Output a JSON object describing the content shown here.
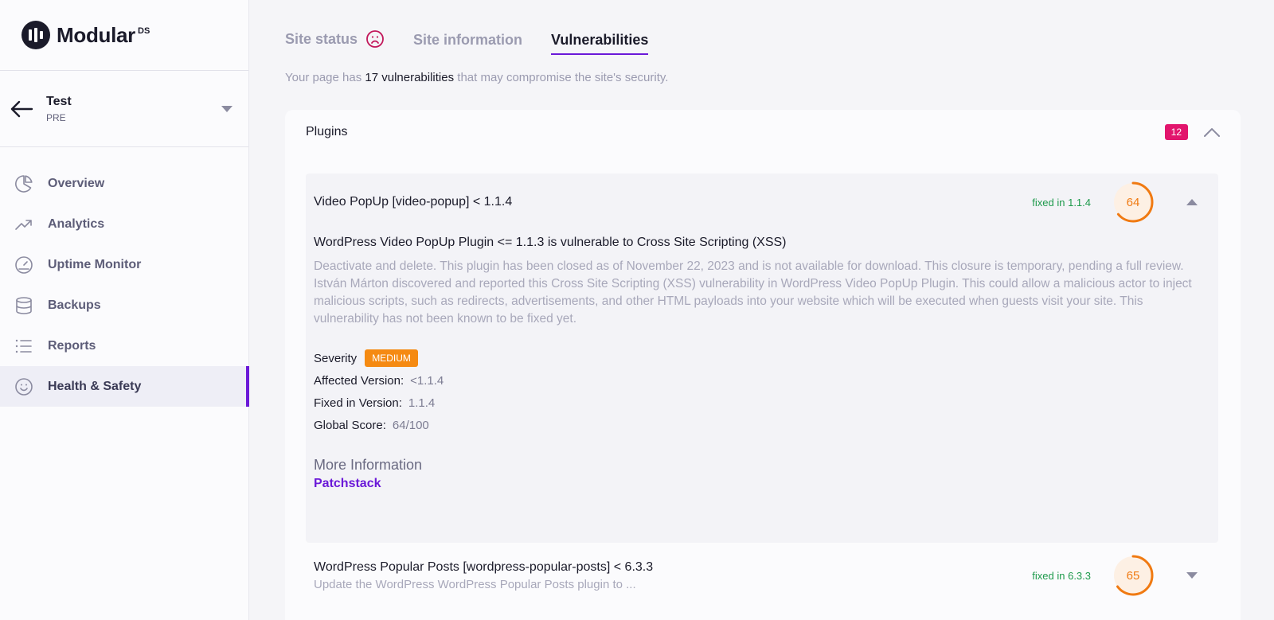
{
  "brand": {
    "name": "Modular",
    "sup": "DS"
  },
  "site": {
    "name": "Test",
    "env": "PRE"
  },
  "nav": [
    {
      "label": "Overview",
      "icon": "pie-chart-icon"
    },
    {
      "label": "Analytics",
      "icon": "trend-up-icon"
    },
    {
      "label": "Uptime Monitor",
      "icon": "gauge-icon"
    },
    {
      "label": "Backups",
      "icon": "database-icon"
    },
    {
      "label": "Reports",
      "icon": "list-icon"
    },
    {
      "label": "Health & Safety",
      "icon": "smile-icon",
      "active": true
    }
  ],
  "tabs": {
    "status": "Site status",
    "info": "Site information",
    "vuln": "Vulnerabilities"
  },
  "intro": {
    "pre": "Your page has ",
    "bold": "17 vulnerabilities",
    "post": " that may compromise the site's security."
  },
  "plugins": {
    "title": "Plugins",
    "count": "12"
  },
  "vuln1": {
    "title": "Video PopUp [video-popup] < 1.1.4",
    "fixed": "fixed in 1.1.4",
    "score": 64,
    "name": "WordPress Video PopUp Plugin <= 1.1.3 is vulnerable to Cross Site Scripting (XSS)",
    "description": "Deactivate and delete. This plugin has been closed as of November 22, 2023 and is not available for download. This closure is temporary, pending a full review. István Márton discovered and reported this Cross Site Scripting (XSS) vulnerability in WordPress Video PopUp Plugin. This could allow a malicious actor to inject malicious scripts, such as redirects, advertisements, and other HTML payloads into your website which will be executed when guests visit your site. This vulnerability has not been known to be fixed yet.",
    "severity_label": "Severity",
    "severity": "MEDIUM",
    "affected_label": "Affected Version:",
    "affected": "<1.1.4",
    "fixed_label": "Fixed in Version:",
    "fixed_version": "1.1.4",
    "global_label": "Global Score:",
    "global": "64/100",
    "more_label": "More Information",
    "more_link": "Patchstack"
  },
  "vuln2": {
    "title": "WordPress Popular Posts [wordpress-popular-posts] < 6.3.3",
    "sub": "Update the WordPress WordPress Popular Posts plugin to ...",
    "fixed": "fixed in 6.3.3",
    "score": 65
  },
  "colors": {
    "accent": "#6b19d8",
    "badge": "#e2156d",
    "severity": "#f58a12",
    "fixed": "#1e9a4c",
    "score": "#f07a12"
  }
}
